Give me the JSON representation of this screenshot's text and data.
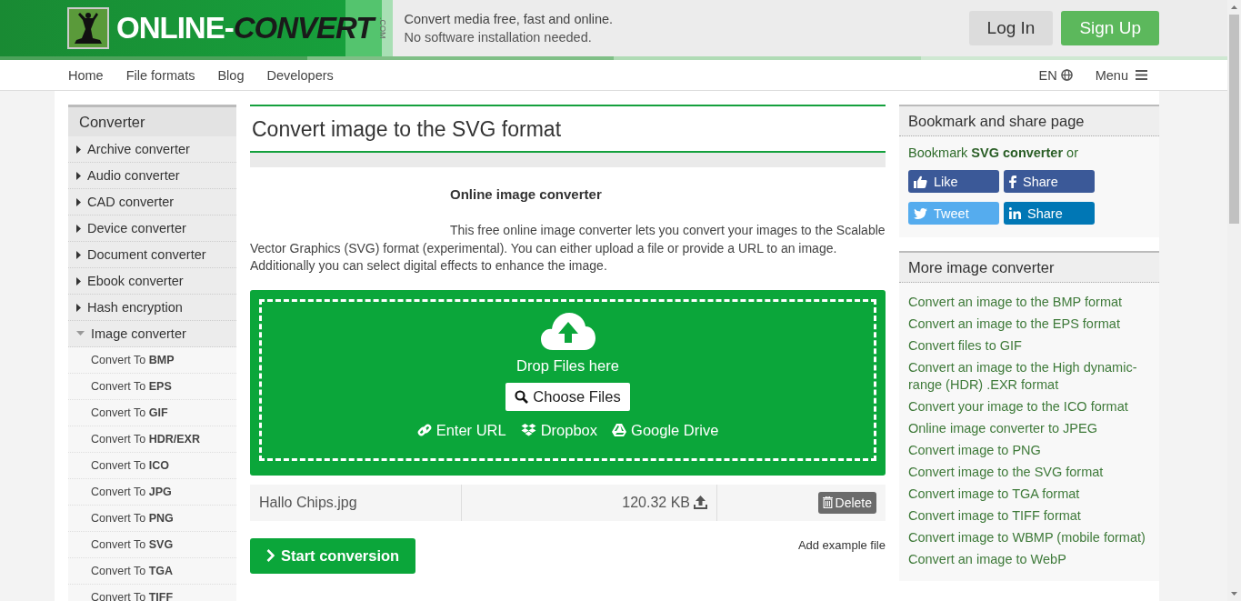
{
  "header": {
    "logo_text": "ONLINE-",
    "logo_text_2": "CONVERT",
    "logo_suffix": ".COM",
    "tagline": "Convert media free, fast and online.",
    "tagline_2": "No software installation needed.",
    "buttons": [
      {
        "label": "Log In",
        "kind": "login"
      },
      {
        "label": "Sign Up",
        "kind": "signup"
      }
    ]
  },
  "nav": {
    "items": [
      "Home",
      "File formats",
      "Blog",
      "Developers"
    ],
    "language": "EN",
    "menu": "Menu"
  },
  "sidebar": {
    "title": "Converter",
    "items": [
      {
        "label": "Archive converter",
        "expanded": false
      },
      {
        "label": "Audio converter",
        "expanded": false
      },
      {
        "label": "CAD converter",
        "expanded": false
      },
      {
        "label": "Device converter",
        "expanded": false
      },
      {
        "label": "Document converter",
        "expanded": false
      },
      {
        "label": "Ebook converter",
        "expanded": false
      },
      {
        "label": "Hash encryption",
        "expanded": false
      },
      {
        "label": "Image converter",
        "expanded": true,
        "children": [
          {
            "label": "Convert To **BMP**"
          },
          {
            "label": "Convert To **EPS**"
          },
          {
            "label": "Convert To **GIF**"
          },
          {
            "label": "Convert To **HDR/EXR**"
          },
          {
            "label": "Convert To **ICO**"
          },
          {
            "label": "Convert To **JPG**"
          },
          {
            "label": "Convert To **PNG**"
          },
          {
            "label": "Convert To **SVG**"
          },
          {
            "label": "Convert To **TGA**"
          },
          {
            "label": "Convert To **TIFF**"
          }
        ]
      }
    ]
  },
  "main": {
    "title": "Convert image to the SVG format",
    "subtitle": "Online image converter",
    "description": "This free online image converter lets you convert your images to the Scalable Vector Graphics (SVG) format (experimental). You can either upload a file or provide a URL to an image. Additionally you can select digital effects to enhance the image.",
    "dropzone": {
      "text": "Drop Files here",
      "choose": "Choose Files",
      "sources": [
        {
          "label": "Enter URL",
          "kind": "url"
        },
        {
          "label": "Dropbox",
          "kind": "dropbox"
        },
        {
          "label": "Google Drive",
          "kind": "drive"
        }
      ]
    },
    "file": {
      "name": "Hallo Chips.jpg",
      "size": "120.32 KB",
      "delete": "Delete"
    },
    "start": "Start conversion",
    "example": "Add example file"
  },
  "share": {
    "title": "Bookmark and share page",
    "text": "Bookmark **SVG converter** or",
    "buttons": [
      {
        "label": "Like",
        "kind": "like",
        "color": "#3b5998"
      },
      {
        "label": "Share",
        "kind": "facebook",
        "color": "#3b5998"
      },
      {
        "label": "Tweet",
        "kind": "twitter",
        "color": "#55acee"
      },
      {
        "label": "Share",
        "kind": "linkedin",
        "color": "#0077b5"
      }
    ]
  },
  "more": {
    "title": "More image converter",
    "links": [
      "Convert an image to the BMP format",
      "Convert an image to the EPS format",
      "Convert files to GIF",
      "Convert an image to the High dynamic-range (HDR) .EXR format",
      "Convert your image to the ICO format",
      "Online image converter to JPEG",
      "Convert image to PNG",
      "Convert image to the SVG format",
      "Convert image to TGA format",
      "Convert image to TIFF format",
      "Convert image to WBMP (mobile format)",
      "Convert an image to WebP"
    ]
  }
}
